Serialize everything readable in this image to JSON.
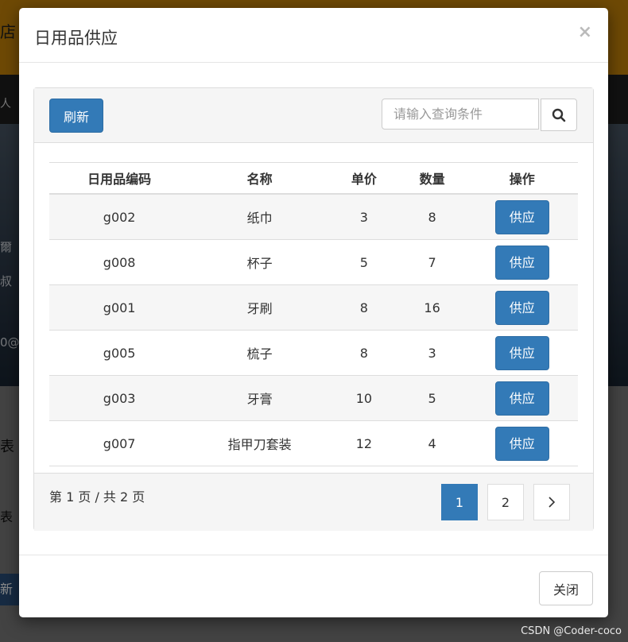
{
  "background": {
    "topbar_text": "店",
    "nav_text": "人",
    "banner_lines": [
      "爾",
      "叔",
      "0@"
    ],
    "lower_texts": [
      "表",
      "表"
    ],
    "lower_button": "新"
  },
  "modal": {
    "title": "日用品供应",
    "close_symbol": "×",
    "toolbar": {
      "refresh_label": "刷新",
      "search_placeholder": "请输入查询条件"
    },
    "table": {
      "headers": [
        "日用品编码",
        "名称",
        "单价",
        "数量",
        "操作"
      ],
      "rows": [
        {
          "code": "g002",
          "name": "纸巾",
          "price": "3",
          "qty": "8",
          "action": "供应"
        },
        {
          "code": "g008",
          "name": "杯子",
          "price": "5",
          "qty": "7",
          "action": "供应"
        },
        {
          "code": "g001",
          "name": "牙刷",
          "price": "8",
          "qty": "16",
          "action": "供应"
        },
        {
          "code": "g005",
          "name": "梳子",
          "price": "8",
          "qty": "3",
          "action": "供应"
        },
        {
          "code": "g003",
          "name": "牙膏",
          "price": "10",
          "qty": "5",
          "action": "供应"
        },
        {
          "code": "g007",
          "name": "指甲刀套装",
          "price": "12",
          "qty": "4",
          "action": "供应"
        }
      ]
    },
    "pagination": {
      "info": "第 1 页 / 共 2 页",
      "pages": [
        "1",
        "2"
      ],
      "active_page": "1",
      "next_symbol": "›"
    },
    "footer": {
      "close_label": "关闭"
    }
  },
  "watermark": "CSDN @Coder-coco",
  "colors": {
    "primary": "#337ab7",
    "topbar": "#c8860a"
  }
}
